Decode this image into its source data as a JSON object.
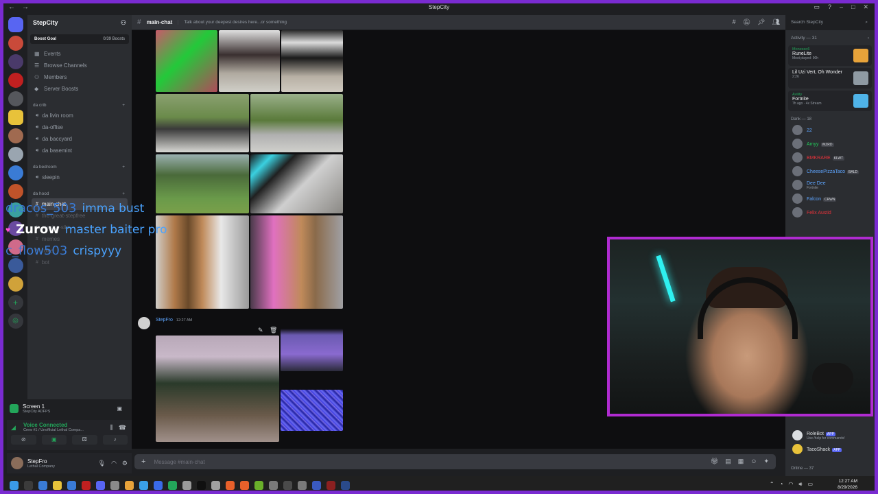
{
  "window": {
    "title": "StepCity"
  },
  "server": {
    "name": "StepCity",
    "boost_goal_label": "Boost Goal",
    "boost_count": "0/39 Boosts"
  },
  "sidebar": {
    "links": [
      {
        "label": "Events",
        "icon": "calendar-icon"
      },
      {
        "label": "Browse Channels",
        "icon": "list-icon"
      },
      {
        "label": "Members",
        "icon": "members-icon"
      },
      {
        "label": "Server Boosts",
        "icon": "boost-icon"
      }
    ],
    "categories": [
      {
        "name": "da crib",
        "channels": [
          "da livin room",
          "da-offise",
          "da baccyard",
          "da basemint"
        ]
      },
      {
        "name": "da bedroom",
        "channels": [
          "sleepin"
        ]
      },
      {
        "name": "da hood",
        "channels": [
          "main-chat",
          "the-great-stepfree",
          "mexico-slio",
          "memes",
          "roles",
          "bot"
        ]
      }
    ]
  },
  "screenshare": {
    "title": "Screen 1",
    "subtitle": "StepCity ADFPS"
  },
  "voice": {
    "status": "Voice Connected",
    "location": "Crew #1 / Unofficial Lethal Compa..."
  },
  "user": {
    "name": "StepFro",
    "status": "Lethal Company"
  },
  "channel": {
    "name": "main-chat",
    "topic": "Talk about your deepest desires here...or something",
    "search_placeholder": "Search StepCity",
    "composer_placeholder": "Message #main-chat"
  },
  "message": {
    "author": "StepFro",
    "time": "12:27 AM"
  },
  "members": {
    "activity_header": "Activity — 31",
    "activities": [
      {
        "user": "Monesso6",
        "title": "RuneLite",
        "detail": "Most played: 90h",
        "thumb_color": "#e8a33a"
      },
      {
        "user": "",
        "title": "Lil Uzi Vert, Oh Wonder",
        "detail": "2:26",
        "thumb_color": "#8f9aa3"
      },
      {
        "user": "Aviiity",
        "title": "Fortnite",
        "detail": "7h ago · 4x Stream",
        "thumb_color": "#4fb3e8"
      }
    ],
    "dank_header": "Dank — 18",
    "dank": [
      {
        "name": "22",
        "status": "",
        "color": "#5ea5ff",
        "tag": ""
      },
      {
        "name": "Amyy",
        "status": "",
        "color": "#23c95a",
        "tag": "WZRD"
      },
      {
        "name": "BMKRARE",
        "status": "",
        "color": "#e8323a",
        "tag": "KLWT"
      },
      {
        "name": "CheesePizzaTaco",
        "status": "",
        "color": "#5ea5ff",
        "tag": "BALD"
      },
      {
        "name": "Dee Dee",
        "status": "Fortnite",
        "color": "#5ea5ff",
        "tag": ""
      },
      {
        "name": "Falcon",
        "status": "",
        "color": "#5ea5ff",
        "tag": "CRWN"
      },
      {
        "name": "Felix Austid",
        "status": "",
        "color": "#e8323a",
        "tag": ""
      }
    ],
    "bots": [
      {
        "name": "RoleBot",
        "status": "Use /help for commands!",
        "tag": "APP"
      },
      {
        "name": "TacoShack",
        "status": "",
        "tag": "APP"
      }
    ],
    "online_header": "Online — 37"
  },
  "stream_chat": [
    {
      "user": "dracos_503",
      "message": "imma bust",
      "white": false
    },
    {
      "user": "Zurow",
      "message": "master baiter pro",
      "white": true
    },
    {
      "user": "c_flow503",
      "message": "crispyyy",
      "white": false
    }
  ],
  "taskbar": {
    "time": "12:27 AM",
    "date": "8/29/2026"
  },
  "colors": {
    "accent": "#7a2bd1",
    "webcam_border": "#b02bd1",
    "voice_green": "#23a55a"
  }
}
